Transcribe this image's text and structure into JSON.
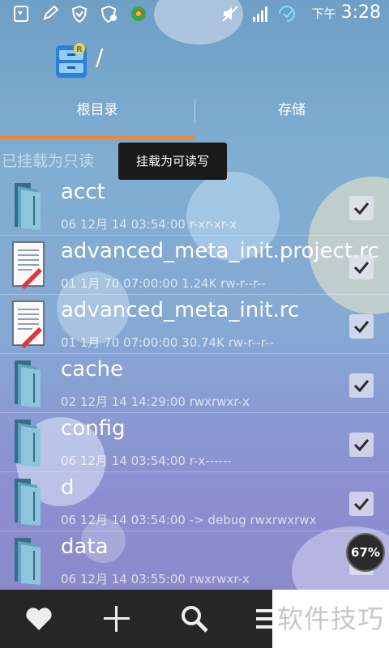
{
  "status_bar": {
    "ampm": "下午",
    "time": "3:28"
  },
  "title_bar": {
    "path": "/"
  },
  "tabs": [
    {
      "label": "根目录"
    },
    {
      "label": "存储"
    }
  ],
  "mount": {
    "label": "已挂载为只读",
    "tooltip": "挂载为可读写"
  },
  "files": [
    {
      "name": "acct",
      "meta": "06 12月 14 03:54:00   r-xr-xr-x",
      "type": "folder",
      "checked": true
    },
    {
      "name": "advanced_meta_init.project.rc",
      "meta": "01 1月 70 07:00:00  1.24K  rw-r--r--",
      "type": "file",
      "checked": true
    },
    {
      "name": "advanced_meta_init.rc",
      "meta": "01 1月 70 07:00:00  30.74K  rw-r--r--",
      "type": "file",
      "checked": true
    },
    {
      "name": "cache",
      "meta": "02 12月 14 14:29:00    rwxrwxr-x",
      "type": "folder",
      "checked": true
    },
    {
      "name": "config",
      "meta": "06 12月 14 03:54:00    r-x------",
      "type": "folder",
      "checked": true
    },
    {
      "name": "d",
      "meta": "06 12月 14 03:54:00  -> debug  rwxrwxrwx",
      "type": "folder",
      "checked": true
    },
    {
      "name": "data",
      "meta": "06 12月 14 03:55:00    rwxrwxr-x",
      "type": "folder",
      "checked": true
    }
  ],
  "zoom_badge": "67%",
  "watermark": "软件技巧",
  "colors": {
    "tab_indicator": "#e88a3c",
    "bottom_bar": "#262626"
  }
}
